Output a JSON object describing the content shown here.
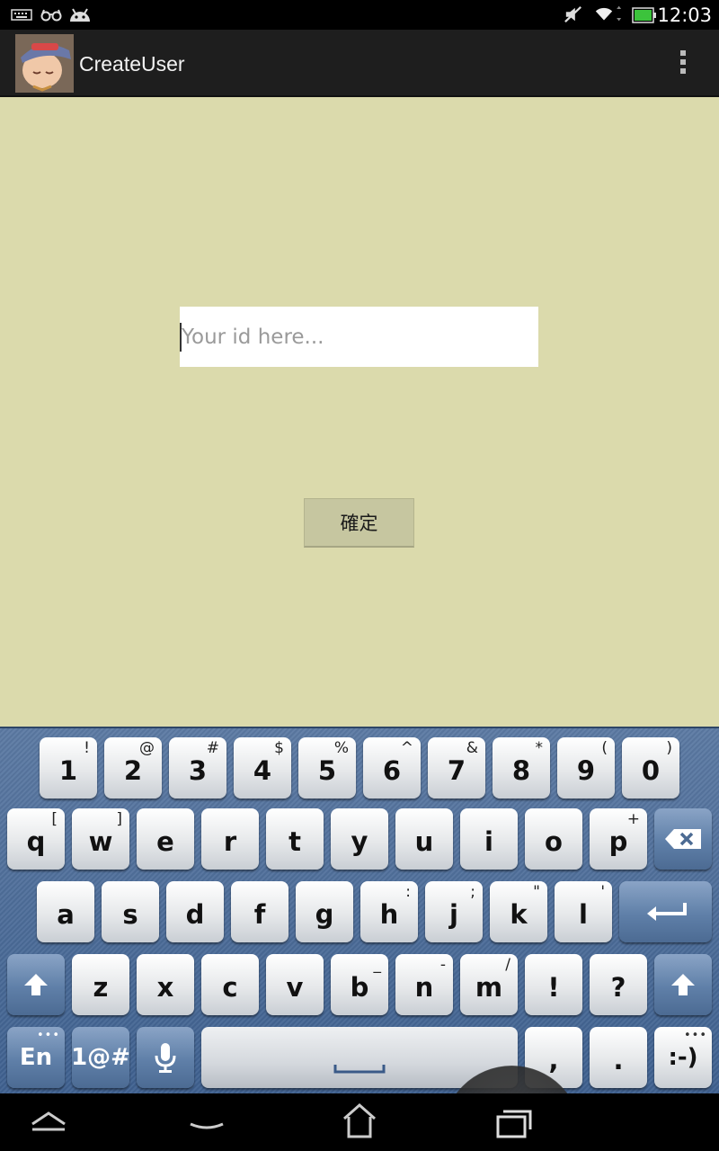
{
  "status_bar": {
    "time": "12:03",
    "icons": [
      "keyboard-icon",
      "glasses-icon",
      "android-icon",
      "no-sound-icon",
      "wifi-icon",
      "battery-icon"
    ]
  },
  "action_bar": {
    "title": "CreateUser",
    "menu_icon": "overflow-menu-icon"
  },
  "form": {
    "id_placeholder": "Your id here...",
    "id_value": "",
    "confirm_label": "確定"
  },
  "colors": {
    "content_bg": "#dbdaac",
    "button_bg": "#c6c6a0",
    "action_bar_bg": "#1e1e1e"
  },
  "keyboard": {
    "row1": [
      {
        "label": "1",
        "alt": "!"
      },
      {
        "label": "2",
        "alt": "@"
      },
      {
        "label": "3",
        "alt": "#"
      },
      {
        "label": "4",
        "alt": "$"
      },
      {
        "label": "5",
        "alt": "%"
      },
      {
        "label": "6",
        "alt": "^"
      },
      {
        "label": "7",
        "alt": "&"
      },
      {
        "label": "8",
        "alt": "*"
      },
      {
        "label": "9",
        "alt": "("
      },
      {
        "label": "0",
        "alt": ")"
      }
    ],
    "row2": [
      {
        "label": "q",
        "alt": "["
      },
      {
        "label": "w",
        "alt": "]"
      },
      {
        "label": "e",
        "alt": ""
      },
      {
        "label": "r",
        "alt": ""
      },
      {
        "label": "t",
        "alt": ""
      },
      {
        "label": "y",
        "alt": ""
      },
      {
        "label": "u",
        "alt": ""
      },
      {
        "label": "i",
        "alt": ""
      },
      {
        "label": "o",
        "alt": ""
      },
      {
        "label": "p",
        "alt": "+"
      }
    ],
    "row3": [
      {
        "label": "a",
        "alt": ""
      },
      {
        "label": "s",
        "alt": ""
      },
      {
        "label": "d",
        "alt": ""
      },
      {
        "label": "f",
        "alt": ""
      },
      {
        "label": "g",
        "alt": ""
      },
      {
        "label": "h",
        "alt": ":"
      },
      {
        "label": "j",
        "alt": ";"
      },
      {
        "label": "k",
        "alt": "\""
      },
      {
        "label": "l",
        "alt": "'"
      }
    ],
    "row4": [
      {
        "label": "z",
        "alt": ""
      },
      {
        "label": "x",
        "alt": ""
      },
      {
        "label": "c",
        "alt": ""
      },
      {
        "label": "v",
        "alt": ""
      },
      {
        "label": "b",
        "alt": "_"
      },
      {
        "label": "n",
        "alt": "-"
      },
      {
        "label": "m",
        "alt": "/"
      },
      {
        "label": "!",
        "alt": ""
      },
      {
        "label": "?",
        "alt": ""
      }
    ],
    "lang_label": "En",
    "symbols_label": "1@#",
    "comma_label": ",",
    "period_label": ".",
    "smiley_label": ":-)"
  }
}
